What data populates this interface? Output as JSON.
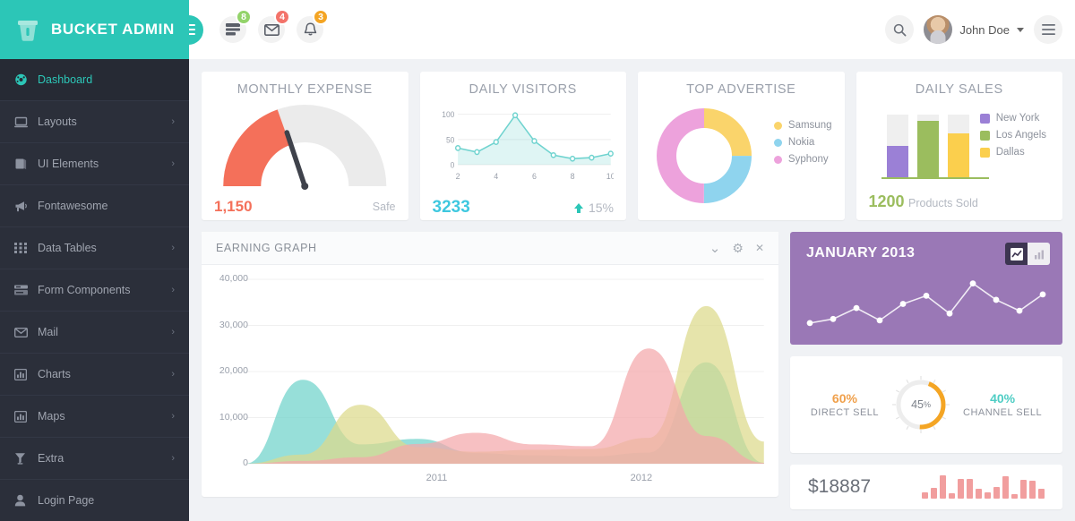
{
  "brand": {
    "title": "BUCKET ADMIN",
    "logo_icon": "bucket-icon",
    "bg": "#2cc6b7"
  },
  "topbar": {
    "menu_toggle_icon": "hamburger-icon",
    "icons": [
      {
        "name": "tasks-icon",
        "badge": "8",
        "badge_color": "#93d36a"
      },
      {
        "name": "mail-icon",
        "badge": "4",
        "badge_color": "#f3736a"
      },
      {
        "name": "bell-icon",
        "badge": "3",
        "badge_color": "#f4a524"
      }
    ],
    "search_icon": "search-icon",
    "user": {
      "name": "John Doe",
      "avatar_icon": "avatar",
      "caret_icon": "chevron-down-icon"
    },
    "right_menu_icon": "hamburger-icon"
  },
  "sidebar": {
    "items": [
      {
        "label": "Dashboard",
        "icon": "dashboard-icon",
        "active": true,
        "has_caret": false
      },
      {
        "label": "Layouts",
        "icon": "laptop-icon",
        "active": false,
        "has_caret": true
      },
      {
        "label": "UI Elements",
        "icon": "book-icon",
        "active": false,
        "has_caret": true
      },
      {
        "label": "Fontawesome",
        "icon": "megaphone-icon",
        "active": false,
        "has_caret": false
      },
      {
        "label": "Data Tables",
        "icon": "grid-icon",
        "active": false,
        "has_caret": true
      },
      {
        "label": "Form Components",
        "icon": "form-icon",
        "active": false,
        "has_caret": true
      },
      {
        "label": "Mail",
        "icon": "envelope-icon",
        "active": false,
        "has_caret": true
      },
      {
        "label": "Charts",
        "icon": "bar-chart-icon",
        "active": false,
        "has_caret": true
      },
      {
        "label": "Maps",
        "icon": "bar-chart-icon",
        "active": false,
        "has_caret": true
      },
      {
        "label": "Extra",
        "icon": "funnel-icon",
        "active": false,
        "has_caret": true
      },
      {
        "label": "Login Page",
        "icon": "user-icon",
        "active": false,
        "has_caret": false
      }
    ]
  },
  "kpi": {
    "monthly_expense": {
      "title": "MONTHLY EXPENSE",
      "value": "1,150",
      "status": "Safe",
      "value_color": "#f4705a"
    },
    "daily_visitors": {
      "title": "DAILY VISITORS",
      "value": "3233",
      "trend": "15%",
      "trend_icon": "arrow-up-icon",
      "value_color": "#3fc8df"
    },
    "top_advertise": {
      "title": "TOP ADVERTISE"
    },
    "daily_sales": {
      "title": "DAILY SALES",
      "value": "1200",
      "sub": "Products Sold",
      "value_color": "#9bbd5e"
    }
  },
  "earning": {
    "title": "EARNING GRAPH",
    "tools": [
      {
        "name": "collapse-icon",
        "glyph": "⌄"
      },
      {
        "name": "gear-icon",
        "glyph": "⚙"
      },
      {
        "name": "close-icon",
        "glyph": "✕"
      }
    ]
  },
  "january": {
    "title": "JANUARY 2013",
    "toggle_line_icon": "line-chart-icon",
    "toggle_bar_icon": "bar-chart-icon"
  },
  "sell": {
    "left_pct": "60%",
    "left_label": "DIRECT SELL",
    "left_color": "#f0a04b",
    "center_pct": "45",
    "center_unit": "%",
    "right_pct": "40%",
    "right_label": "CHANNEL SELL",
    "right_color": "#4ecdc4"
  },
  "money": {
    "value": "$18887"
  },
  "chart_data": [
    {
      "type": "line",
      "title": "DAILY VISITORS",
      "x": [
        2,
        3,
        4,
        5,
        6,
        7,
        8,
        9,
        10
      ],
      "values": [
        33,
        25,
        45,
        98,
        47,
        19,
        12,
        14,
        22
      ],
      "xticks": [
        "2",
        "4",
        "6",
        "8",
        "10"
      ],
      "yticks": [
        "0",
        "50",
        "100"
      ],
      "ylim": [
        0,
        110
      ],
      "grid": true,
      "color": "#6fd3cf"
    },
    {
      "type": "pie",
      "title": "TOP ADVERTISE",
      "labels": [
        "Samsung",
        "Nokia",
        "Syphony"
      ],
      "values": [
        25,
        25,
        50
      ],
      "colors": [
        "#fad46b",
        "#8fd4ee",
        "#eda2dc"
      ],
      "legend": "right",
      "donut": true
    },
    {
      "type": "bar",
      "title": "DAILY SALES",
      "categories": [
        "New York",
        "Los Angels",
        "Dallas"
      ],
      "values": [
        50,
        90,
        70
      ],
      "ylim": [
        0,
        100
      ],
      "colors": [
        "#9b80d6",
        "#9bbd5e",
        "#fbcf4d"
      ],
      "legend": "right"
    },
    {
      "type": "area",
      "title": "EARNING GRAPH",
      "xlabel": "",
      "ylabel": "",
      "xticks": [
        "2011",
        "2012"
      ],
      "yticks": [
        "0",
        "10,000",
        "20,000",
        "30,000",
        "40,000"
      ],
      "ylim": [
        0,
        40000
      ],
      "grid": true,
      "series": [
        {
          "name": "teal",
          "color": "#6fd3cb",
          "values": [
            0,
            18200,
            4200,
            5400,
            2300,
            1800,
            1600,
            2400,
            22000,
            200
          ]
        },
        {
          "name": "yellow",
          "color": "#ddd98a",
          "values": [
            0,
            2000,
            12800,
            3600,
            2600,
            3000,
            3200,
            5600,
            34200,
            4800
          ]
        },
        {
          "name": "pink",
          "color": "#f4a7ab",
          "values": [
            0,
            600,
            1400,
            4300,
            6700,
            4200,
            3800,
            25000,
            6000,
            200
          ]
        }
      ]
    },
    {
      "type": "line",
      "title": "JANUARY 2013",
      "values": [
        8,
        14,
        30,
        12,
        36,
        48,
        22,
        66,
        42,
        26,
        50
      ],
      "color": "#ffffff",
      "grid": false
    },
    {
      "type": "gauge",
      "title": "MONTHLY EXPENSE",
      "value": 1150,
      "needle_pct": 38,
      "arc_pct": 40,
      "arc_color": "#f4705a",
      "track_color": "#ebebeb"
    },
    {
      "type": "gauge",
      "title": "Sell Split",
      "value": 45,
      "arc_color": "#f4a524",
      "track_color": "#ededed"
    },
    {
      "type": "bar",
      "title": "Revenue sparkline",
      "values": [
        6,
        10,
        22,
        5,
        19,
        19,
        9,
        6,
        11,
        21,
        4,
        18,
        17,
        9
      ],
      "color": "#f19e9e"
    }
  ]
}
